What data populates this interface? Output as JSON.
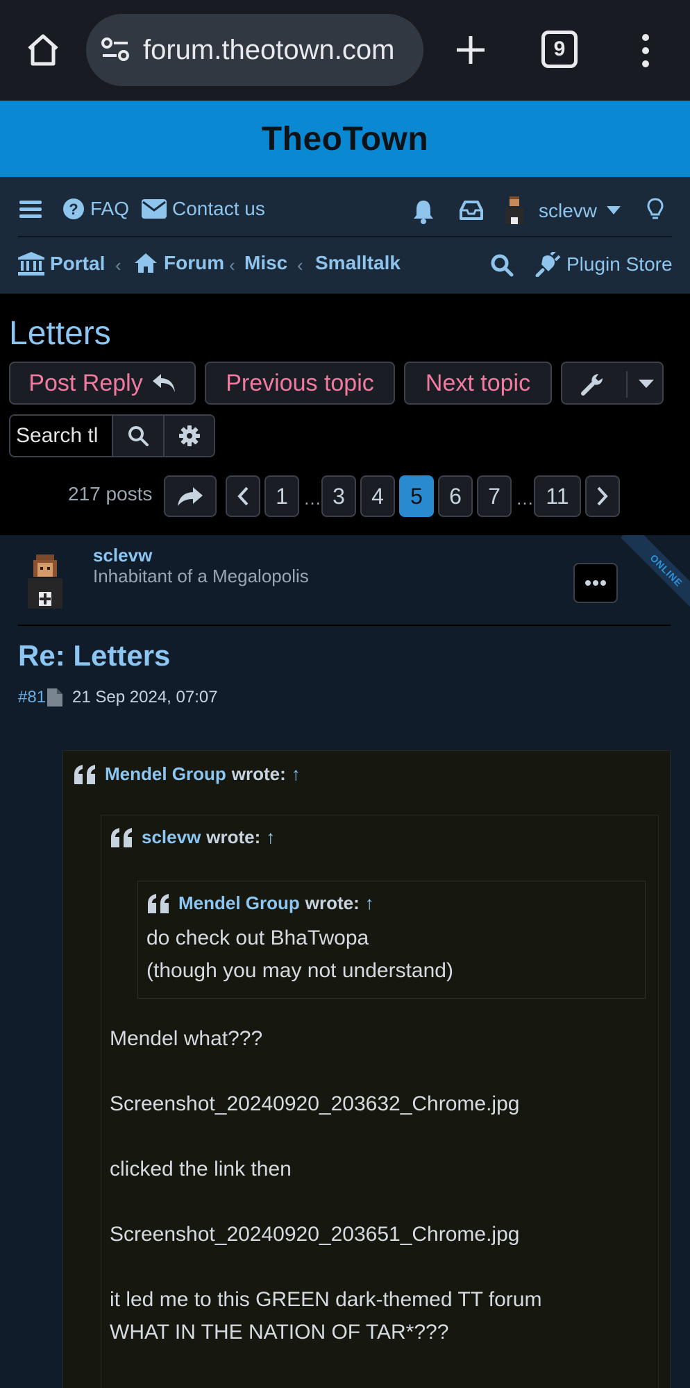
{
  "browser": {
    "url": "forum.theotown.com",
    "tab_count": "9"
  },
  "site": {
    "title": "TheoTown"
  },
  "nav": {
    "faq": "FAQ",
    "contact": "Contact us",
    "username": "sclevw",
    "breadcrumbs": {
      "portal": "Portal",
      "forum": "Forum",
      "misc": "Misc",
      "smalltalk": "Smalltalk"
    },
    "plugin_store": "Plugin Store",
    "crumb_separator": "‹"
  },
  "topic": {
    "title": "Letters",
    "buttons": {
      "post_reply": "Post Reply",
      "previous": "Previous topic",
      "next": "Next topic"
    },
    "search_placeholder": "Search this topic…",
    "search_value": "Search tl",
    "post_count": "217 posts",
    "pagination": {
      "pages": [
        "1",
        "3",
        "4",
        "5",
        "6",
        "7",
        "11"
      ],
      "ellipsis": "…",
      "current": "5"
    }
  },
  "post": {
    "online_label": "ONLINE",
    "author": "sclevw",
    "rank": "Inhabitant of a Megalopolis",
    "title": "Re: Letters",
    "number": "#81",
    "date": "21 Sep 2024, 07:07",
    "quote_outer": {
      "author": "Mendel Group",
      "wrote": "wrote:",
      "arrow": "↑"
    },
    "quote_middle": {
      "author": "sclevw",
      "wrote": "wrote:",
      "arrow": "↑",
      "lines": [
        "Mendel what???",
        "Screenshot_20240920_203632_Chrome.jpg",
        "clicked the link then",
        "Screenshot_20240920_203651_Chrome.jpg",
        "it led me to this GREEN dark-themed TT forum",
        "WHAT IN THE NATION OF TAR*???"
      ]
    },
    "quote_inner": {
      "author": "Mendel Group",
      "wrote": "wrote:",
      "arrow": "↑",
      "lines": [
        "do check out BhaTwopa",
        "(though you may not understand)"
      ]
    }
  }
}
